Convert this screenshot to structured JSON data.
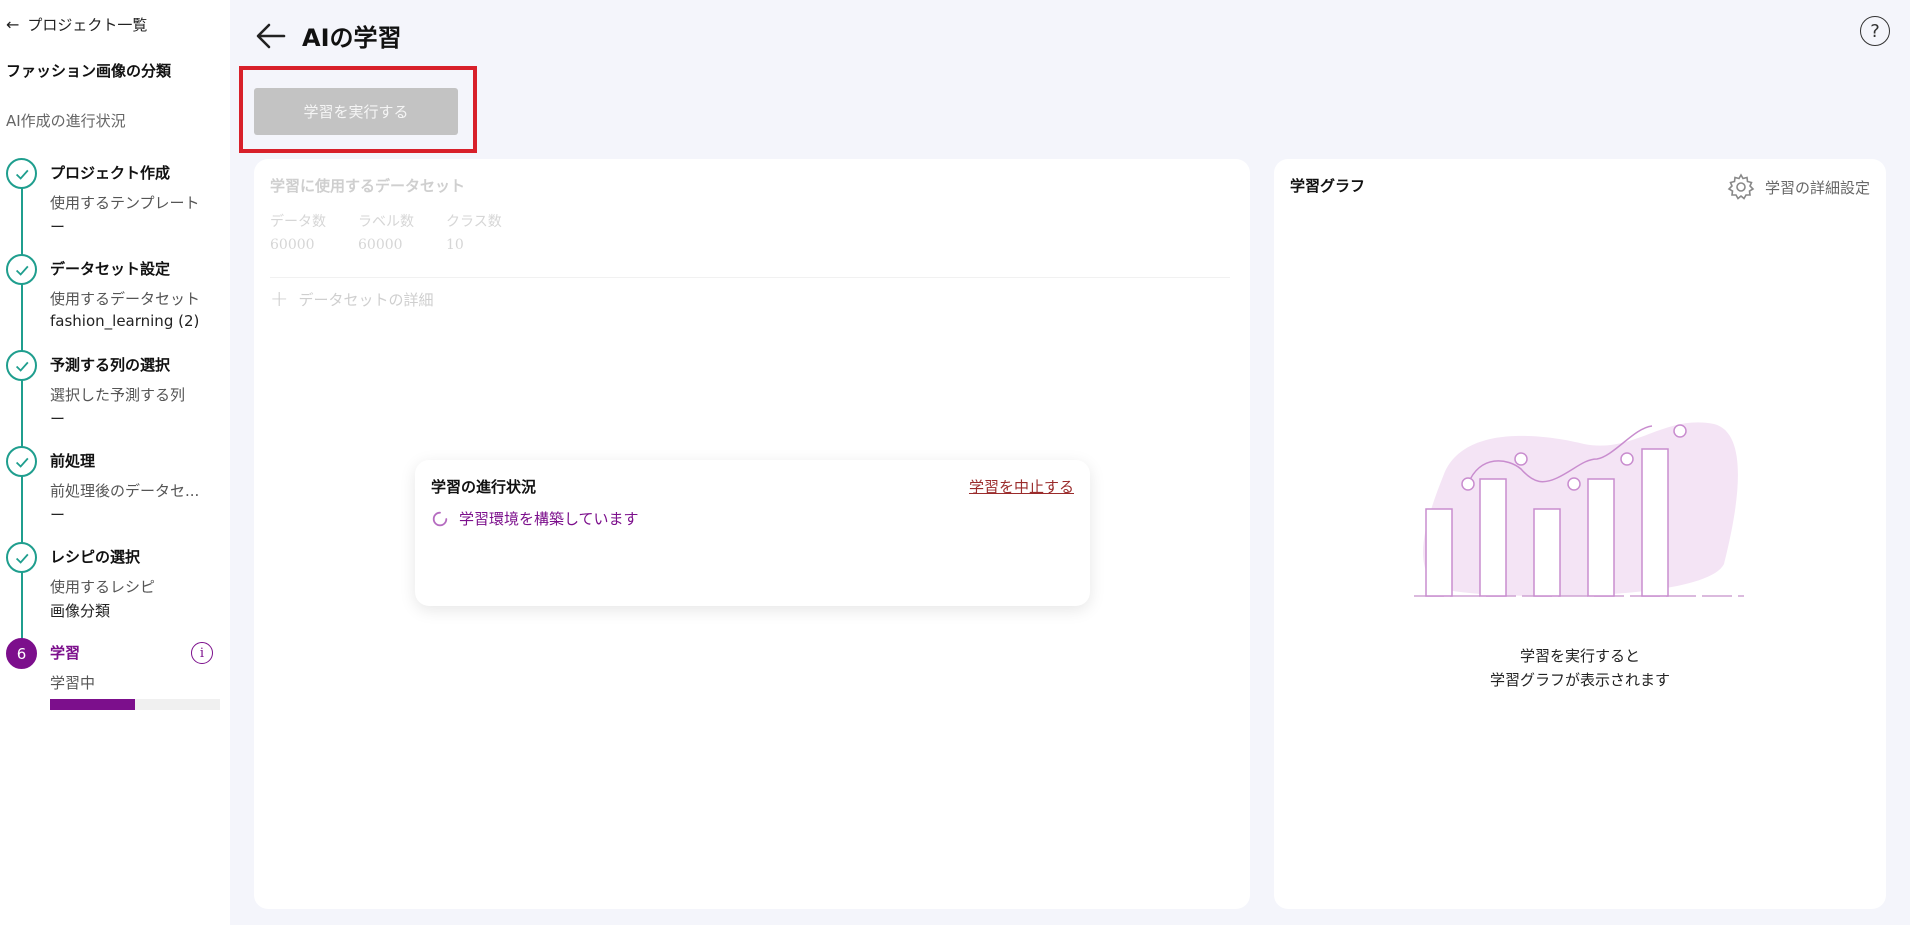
{
  "sidebar": {
    "back_label": "プロジェクト一覧",
    "project_name": "ファッション画像の分類",
    "progress_title": "AI作成の進行状況",
    "steps": [
      {
        "title": "プロジェクト作成",
        "label": "使用するテンプレート",
        "value": "ー",
        "status": "done"
      },
      {
        "title": "データセット設定",
        "label": "使用するデータセット",
        "value": "fashion_learning (2)",
        "status": "done"
      },
      {
        "title": "予測する列の選択",
        "label": "選択した予測する列",
        "value": "ー",
        "status": "done"
      },
      {
        "title": "前処理",
        "label": "前処理後のデータセ...",
        "value": "ー",
        "status": "done"
      },
      {
        "title": "レシピの選択",
        "label": "使用するレシピ",
        "value": "画像分類",
        "status": "done"
      },
      {
        "number": "6",
        "title": "学習",
        "label": "学習中",
        "status": "active",
        "progress": 0.5
      }
    ]
  },
  "header": {
    "title": "AIの学習"
  },
  "run_button_label": "学習を実行する",
  "dataset_panel": {
    "title": "学習に使用するデータセット",
    "stats": [
      {
        "label": "データ数",
        "value": "60000"
      },
      {
        "label": "ラベル数",
        "value": "60000"
      },
      {
        "label": "クラス数",
        "value": "10"
      }
    ],
    "detail_label": "データセットの詳細"
  },
  "status_card": {
    "title": "学習の進行状況",
    "stop_label": "学習を中止する",
    "message": "学習環境を構築しています"
  },
  "graph_panel": {
    "title": "学習グラフ",
    "settings_label": "学習の詳細設定",
    "empty_line1": "学習を実行すると",
    "empty_line2": "学習グラフが表示されます"
  },
  "colors": {
    "accent": "#7c0f8c",
    "step_done": "#1f9e8e",
    "highlight": "#d8202a"
  }
}
